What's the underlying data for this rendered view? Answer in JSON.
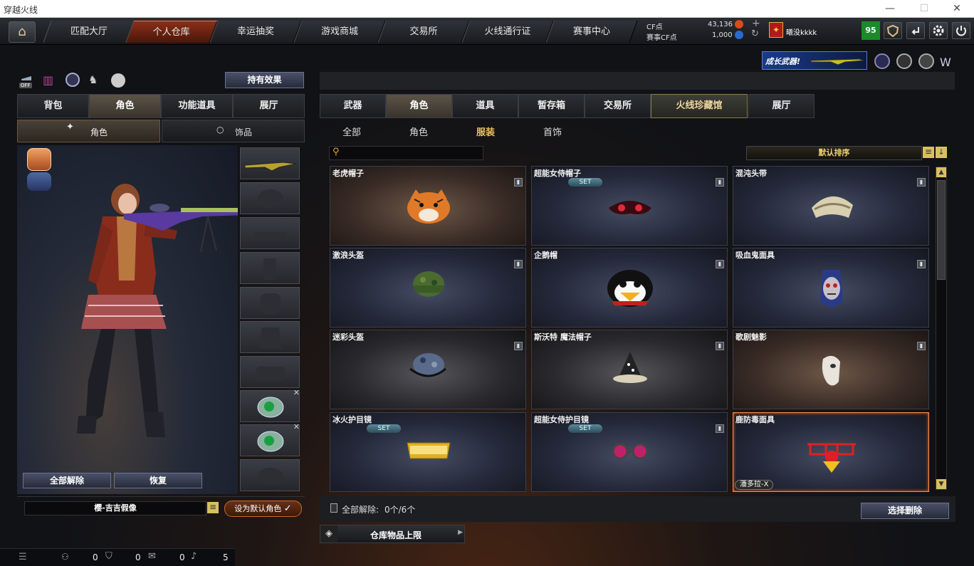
{
  "window": {
    "title": "穿越火线",
    "controls": [
      "—",
      "☐",
      "✕"
    ]
  },
  "nav": {
    "tabs": [
      "匹配大厅",
      "个人仓库",
      "幸运抽奖",
      "游戏商城",
      "交易所",
      "火线通行证",
      "赛事中心"
    ],
    "active_index": 1
  },
  "currency": {
    "cf_label": "CF点",
    "cf_value": "43,136",
    "event_label": "赛事CF点",
    "event_value": "1,000"
  },
  "user": {
    "name": "曦没kkkk",
    "level": "95"
  },
  "banner": {
    "text": "成长武器!"
  },
  "left": {
    "effect_button": "持有效果",
    "toggle_off": "OFF",
    "tabs": [
      "背包",
      "角色",
      "功能道具",
      "展厅"
    ],
    "active_tab": 1,
    "subtabs": [
      "角色",
      "饰品"
    ],
    "unequip_all": "全部解除",
    "restore": "恢复",
    "character_name": "樱-吉吉假像",
    "set_default": "设为默认角色"
  },
  "right": {
    "tabs": [
      "武器",
      "角色",
      "道具",
      "暂存箱",
      "交易所",
      "火线珍藏馆",
      "展厅"
    ],
    "active_tab": 1,
    "special_tab": 5,
    "subtabs": [
      "全部",
      "角色",
      "服装",
      "首饰"
    ],
    "active_subtab": 2,
    "search_placeholder": "",
    "sort_label": "默认排序",
    "items": [
      {
        "name": "老虎帽子",
        "set": "",
        "tag": "",
        "bg": "warm",
        "icon": "tiger-hat"
      },
      {
        "name": "超能女侍帽子",
        "set": "SET",
        "tag": "",
        "bg": "cool",
        "icon": "maid-hat"
      },
      {
        "name": "混沌头带",
        "set": "",
        "tag": "",
        "bg": "cool",
        "icon": "chaos-headband"
      },
      {
        "name": "激浪头盔",
        "set": "",
        "tag": "",
        "bg": "cool",
        "icon": "camo-helmet"
      },
      {
        "name": "企鹅帽",
        "set": "",
        "tag": "",
        "bg": "cool",
        "icon": "penguin-hat"
      },
      {
        "name": "吸血鬼面具",
        "set": "",
        "tag": "",
        "bg": "cool",
        "icon": "vampire-mask"
      },
      {
        "name": "迷彩头盔",
        "set": "",
        "tag": "",
        "bg": "dark",
        "icon": "blue-camo-helmet"
      },
      {
        "name": "斯沃特 魔法帽子",
        "set": "",
        "tag": "",
        "bg": "dark",
        "icon": "witch-hat"
      },
      {
        "name": "歌剧魅影",
        "set": "",
        "tag": "",
        "bg": "warm",
        "icon": "opera-mask"
      },
      {
        "name": "冰火护目镜",
        "set": "SET",
        "tag": "",
        "bg": "cool",
        "icon": "gold-goggles"
      },
      {
        "name": "超能女侍护目镜",
        "set": "SET",
        "tag": "",
        "bg": "cool",
        "icon": "pink-goggles"
      },
      {
        "name": "鹿防毒面具",
        "set": "",
        "tag": "潘多拉-X",
        "bg": "cool",
        "icon": "clown-glasses"
      }
    ],
    "selected_item": 11,
    "unequip_status_label": "全部解除:",
    "unequip_status_value": "0个/6个",
    "select_delete": "选择删除",
    "storage_limit": "仓库物品上限"
  },
  "status_bar": {
    "counts": [
      "0",
      "0",
      "0",
      "5"
    ]
  }
}
